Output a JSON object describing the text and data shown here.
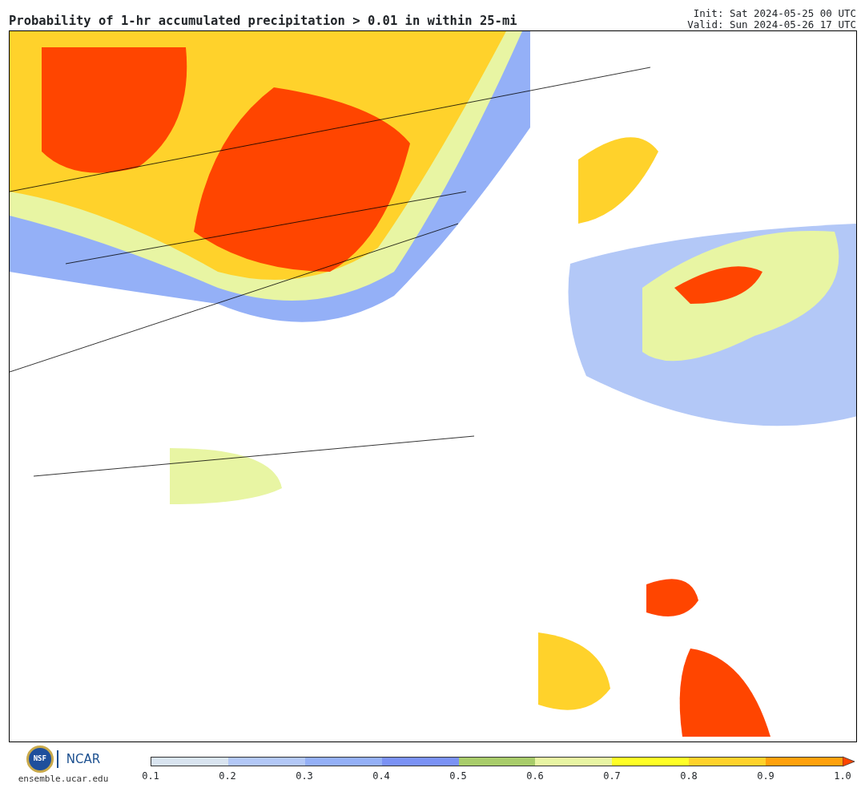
{
  "header": {
    "title": "Probability of 1-hr accumulated precipitation > 0.01 in within 25-mi",
    "init": "Init: Sat 2024-05-25 00 UTC",
    "valid": "Valid: Sun 2024-05-26 17 UTC"
  },
  "footer": {
    "logos": [
      "NSF",
      "NCAR"
    ],
    "site": "ensemble.ucar.edu"
  },
  "colorbar": {
    "segments": [
      {
        "color": "#d9e4f0"
      },
      {
        "color": "#b3c8f7"
      },
      {
        "color": "#94b0f7"
      },
      {
        "color": "#7b92f5"
      },
      {
        "color": "#a8cc6a"
      },
      {
        "color": "#e8f5a3"
      },
      {
        "color": "#ffff26"
      },
      {
        "color": "#ffd22b"
      },
      {
        "color": "#ffa10d"
      }
    ],
    "extension": {
      "color": "#ff4500"
    },
    "ticks": [
      "0.1",
      "0.2",
      "0.3",
      "0.4",
      "0.5",
      "0.6",
      "0.7",
      "0.8",
      "0.9",
      "1.0"
    ]
  }
}
